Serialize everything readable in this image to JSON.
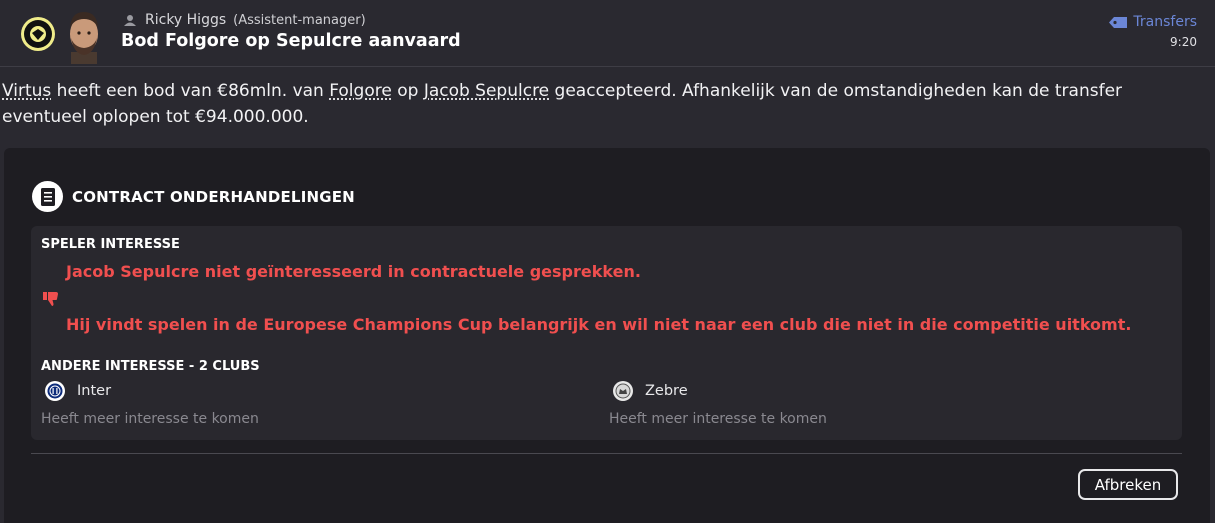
{
  "header": {
    "sender_name": "Ricky Higgs",
    "sender_role": "(Assistent-manager)",
    "title": "Bod Folgore op Sepulcre aanvaard",
    "category": "Transfers",
    "time": "9:20",
    "icons": {
      "club": "club-badge-icon",
      "sender": "person-icon",
      "category": "tag-icon"
    }
  },
  "body": {
    "p1": "Virtus",
    "p2": " heeft een bod van €86mln. van ",
    "p3": "Folgore",
    "p4": " op ",
    "p5": "Jacob Sepulcre",
    "p6": " geaccepteerd. Afhankelijk van de omstandigheden kan de transfer eventueel oplopen tot €94.000.000."
  },
  "contract": {
    "section_title": "CONTRACT ONDERHANDELINGEN",
    "player_interest_title": "SPELER INTERESSE",
    "message1": "Jacob Sepulcre niet geïnteresseerd in contractuele gesprekken.",
    "message2": "Hij vindt spelen in de Europese Champions Cup belangrijk en wil niet naar een club die niet in die competitie uitkomt.",
    "other_interest_title": "ANDERE INTERESSE - 2 CLUBS",
    "clubs": [
      {
        "name": "Inter",
        "note": "Heeft meer interesse te komen"
      },
      {
        "name": "Zebre",
        "note": "Heeft meer interesse te komen"
      }
    ]
  },
  "actions": {
    "cancel_label": "Afbreken"
  },
  "colors": {
    "accent_blue": "#6b86d6",
    "negative_red": "#f04f4f",
    "badge_yellow": "#f0ec8a"
  }
}
